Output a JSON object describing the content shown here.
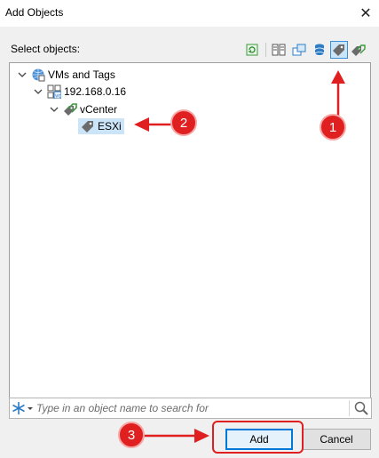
{
  "window": {
    "title": "Add Objects"
  },
  "dialog": {
    "select_label": "Select objects:"
  },
  "toolbar": {
    "buttons": [
      {
        "icon": "refresh-icon",
        "active": false
      },
      {
        "icon": "hosts-and-clusters-icon",
        "active": false
      },
      {
        "icon": "vms-and-templates-icon",
        "active": false
      },
      {
        "icon": "datastores-icon",
        "active": false
      },
      {
        "icon": "tag-icon",
        "active": true
      },
      {
        "icon": "tags-and-categories-icon",
        "active": false
      }
    ]
  },
  "tree": {
    "nodes": [
      {
        "label": "VMs and Tags",
        "icon": "vms-and-tags-icon",
        "level": 0,
        "expanded": true,
        "selected": false
      },
      {
        "label": "192.168.0.16",
        "icon": "vcenter-server-icon",
        "level": 1,
        "expanded": true,
        "selected": false
      },
      {
        "label": "vCenter",
        "icon": "tag-category-icon",
        "level": 2,
        "expanded": true,
        "selected": false
      },
      {
        "label": "ESXi",
        "icon": "tag-icon",
        "level": 3,
        "expanded": false,
        "selected": true
      }
    ]
  },
  "search": {
    "placeholder": "Type in an object name to search for",
    "value": ""
  },
  "buttons": {
    "add_label": "Add",
    "cancel_label": "Cancel"
  },
  "annotations": {
    "markers": [
      "1",
      "2",
      "3"
    ],
    "color": "#e02020"
  },
  "colors": {
    "selection": "#cce4f7",
    "accent": "#0078d7",
    "annotation": "#e02020"
  }
}
